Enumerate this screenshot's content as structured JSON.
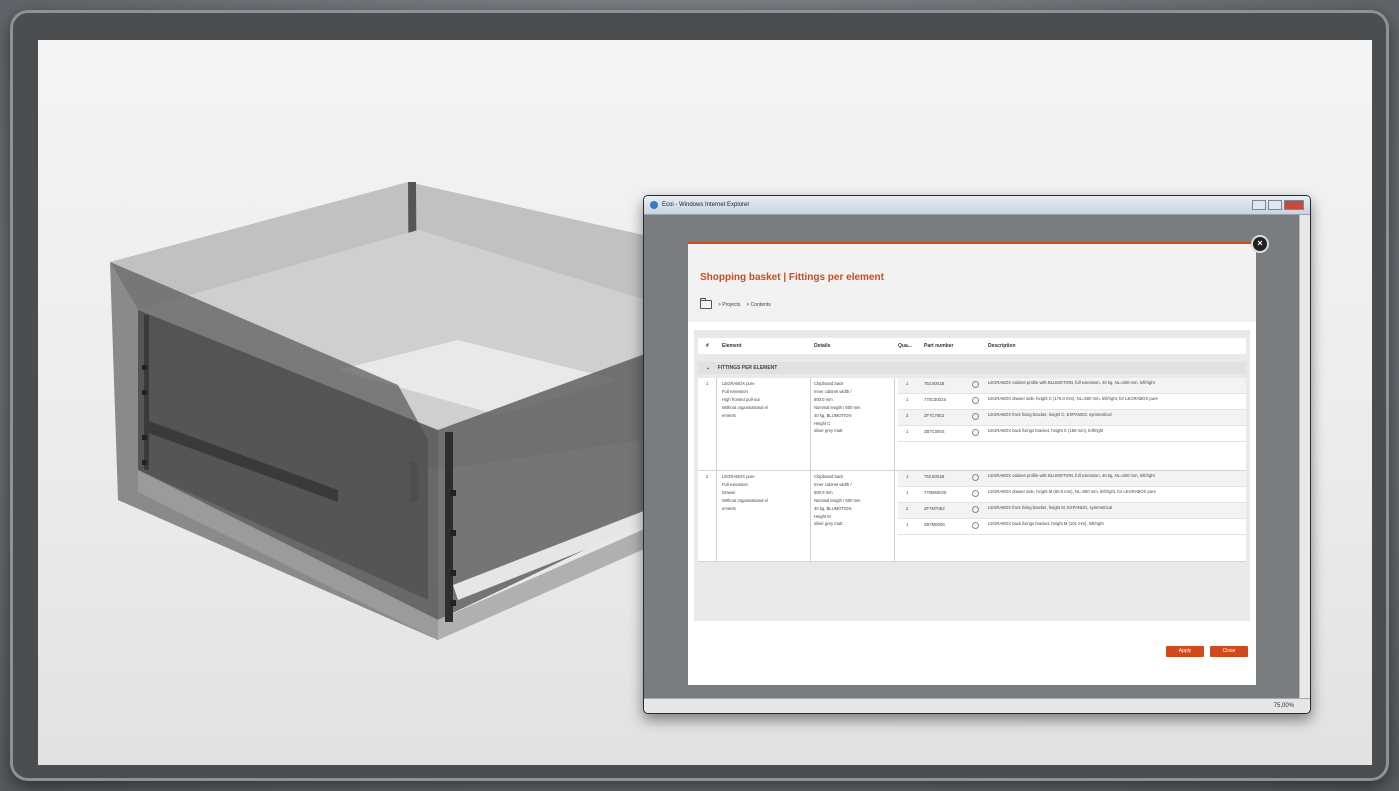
{
  "window": {
    "title": "Ecoi - Windows Internet Explorer",
    "zoom": "75,00%"
  },
  "dialog": {
    "title": "Shopping basket | Fittings per element",
    "close_symbol": "×",
    "breadcrumbs": [
      "> Projects",
      "> Contents"
    ]
  },
  "table": {
    "headers": [
      "#",
      "Element",
      "Details",
      "Qua...",
      "Part number",
      "Description"
    ],
    "group_label": "FITTINGS PER ELEMENT",
    "group_chevron": "⌄",
    "elements": [
      {
        "number": "1",
        "element": [
          "LEGRABOX pure",
          "Full extension",
          "High fronted pull-out",
          "Without organisational el",
          "ements"
        ],
        "details": [
          "Chipboard back",
          "Inner cabinet width /",
          "500.0 mm",
          "Nominal length / 500 mm",
          "40 kg, BLUMOTION",
          "Height C",
          "silver grey matt"
        ],
        "parts": [
          {
            "qty": "1",
            "part": "753.5001B",
            "desc": "LEGRABOX cabinet profile with BLUMOTION, full extension, 40 kg, NL=500 mm, left/right"
          },
          {
            "qty": "1",
            "part": "770C5002S",
            "desc": "LEGRABOX drawer side, height C (176.0 mm), NL=500 mm, left/right, for LEGRABOX pure"
          },
          {
            "qty": "2",
            "part": "ZF7C70E2",
            "desc": "LEGRABOX front fixing bracket, height C, EXPANDO, symmetrical"
          },
          {
            "qty": "1",
            "part": "ZB7C000S",
            "desc": "LEGRABOX back fixings bracket, height C (168 mm), left/right"
          }
        ]
      },
      {
        "number": "2",
        "element": [
          "LEGRABOX pure",
          "Full extension",
          "Drawer",
          "Without organisational el",
          "ements"
        ],
        "details": [
          "Chipboard back",
          "Inner cabinet width /",
          "500.0 mm",
          "Nominal length / 500 mm",
          "40 kg, BLUMOTION",
          "Height M",
          "silver grey matt"
        ],
        "parts": [
          {
            "qty": "1",
            "part": "753.5001B",
            "desc": "LEGRABOX cabinet profile with BLUMOTION, full extension, 40 kg, NL=500 mm, left/right"
          },
          {
            "qty": "1",
            "part": "770M5002S",
            "desc": "LEGRABOX drawer side, height M (90.5 mm), NL=500 mm, left/right, for LEGRABOX pure"
          },
          {
            "qty": "2",
            "part": "ZF7M70E2",
            "desc": "LEGRABOX front fixing bracket, height M, EXPANDO, symmetrical"
          },
          {
            "qty": "1",
            "part": "ZB7M000S",
            "desc": "LEGRABOX back fixings bracket, height M (101 mm), left/right"
          }
        ]
      }
    ]
  },
  "buttons": {
    "primary": "Apply",
    "secondary": "Close"
  },
  "colors": {
    "accent": "#d04a1c",
    "frame": "#4b4e51"
  }
}
